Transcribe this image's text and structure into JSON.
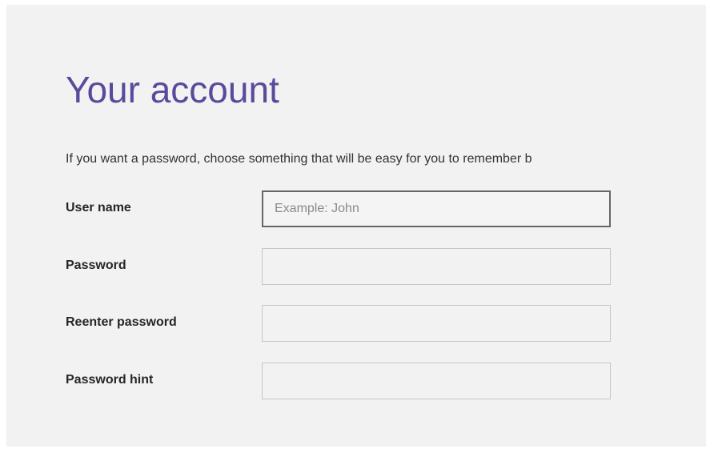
{
  "page": {
    "title": "Your account",
    "description": "If you want a password, choose something that will be easy for you to remember b"
  },
  "form": {
    "username": {
      "label": "User name",
      "value": "",
      "placeholder": "Example: John"
    },
    "password": {
      "label": "Password",
      "value": "",
      "placeholder": ""
    },
    "reenter_password": {
      "label": "Reenter password",
      "value": "",
      "placeholder": ""
    },
    "password_hint": {
      "label": "Password hint",
      "value": "",
      "placeholder": ""
    }
  },
  "colors": {
    "title": "#5b4a9c",
    "background": "#f2f2f2",
    "focused_border": "#666666"
  }
}
